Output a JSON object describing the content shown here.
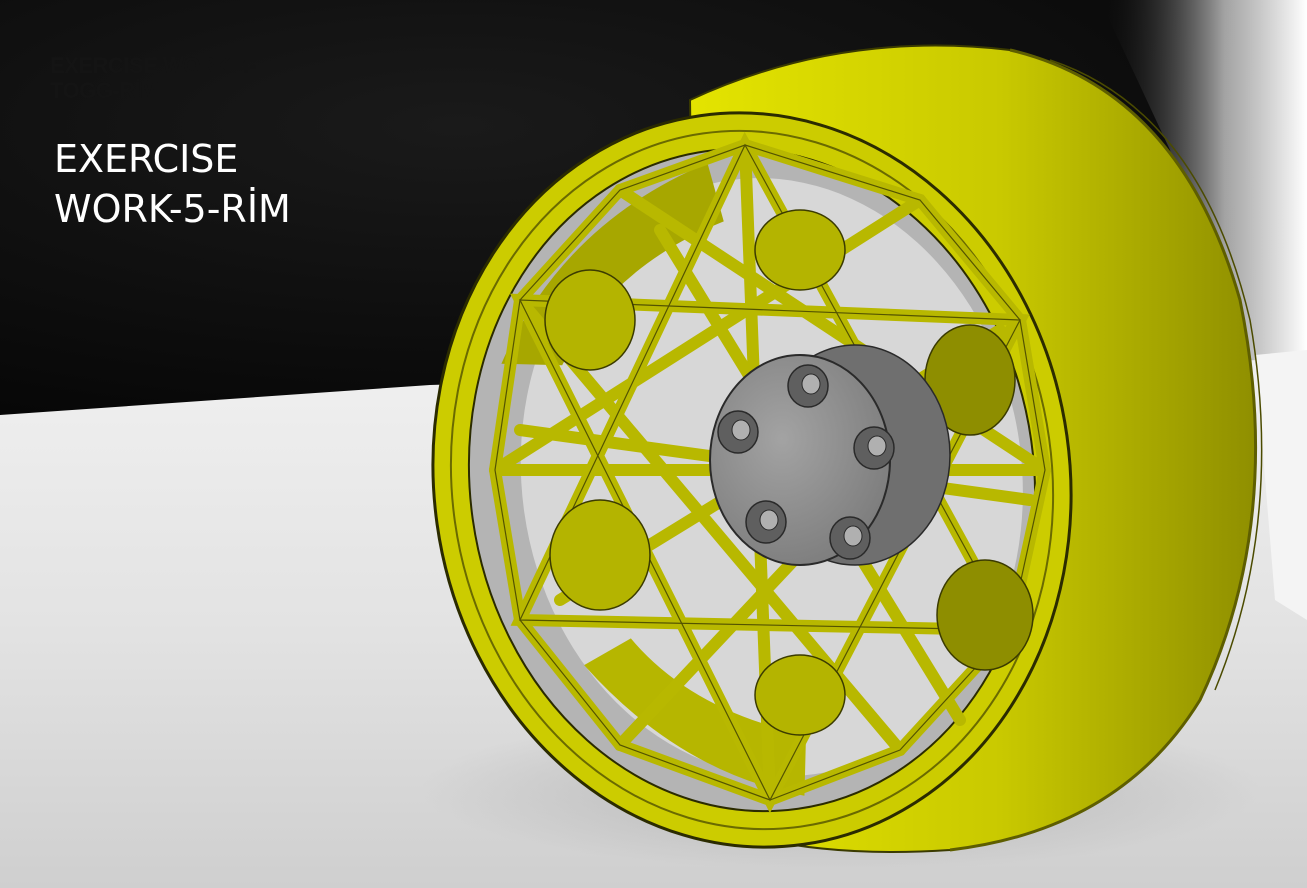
{
  "overlay_titles": {
    "previous_title_line1": "EXERCISE WORK-4-",
    "previous_title_line2": "TOGG-RİM",
    "current_title_line1": "EXERCISE",
    "current_title_line2": "WORK-5-RİM"
  },
  "colors": {
    "rim_yellow": "#d2d200",
    "rim_shadow": "#7f7f00",
    "hub_gray": "#8d8d8d",
    "background_dark": "#0e0e0e",
    "floor_light": "#e8e8e8"
  },
  "icons": {
    "wheel": "rim-3d-model",
    "hub": "lug-nut-hub"
  }
}
